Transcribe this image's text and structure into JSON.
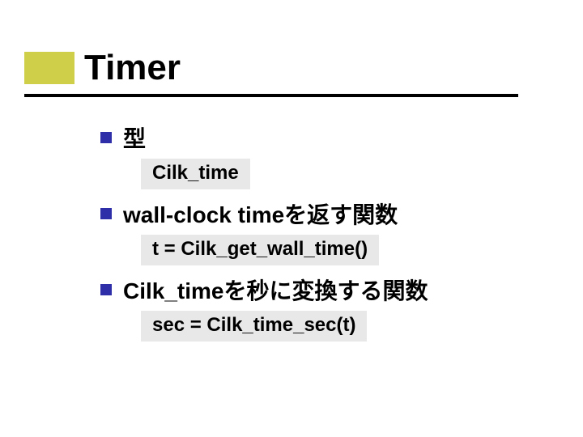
{
  "title": "Timer",
  "items": [
    {
      "label": "型",
      "code": "Cilk_time"
    },
    {
      "label": "wall-clock timeを返す関数",
      "code": "t = Cilk_get_wall_time()"
    },
    {
      "label": "Cilk_timeを秒に変換する関数",
      "code": "sec = Cilk_time_sec(t)"
    }
  ],
  "colors": {
    "title_box": "#cfcf4a",
    "bullet": "#2e2ea8",
    "code_bg": "#e8e8e8",
    "underline": "#000000"
  }
}
